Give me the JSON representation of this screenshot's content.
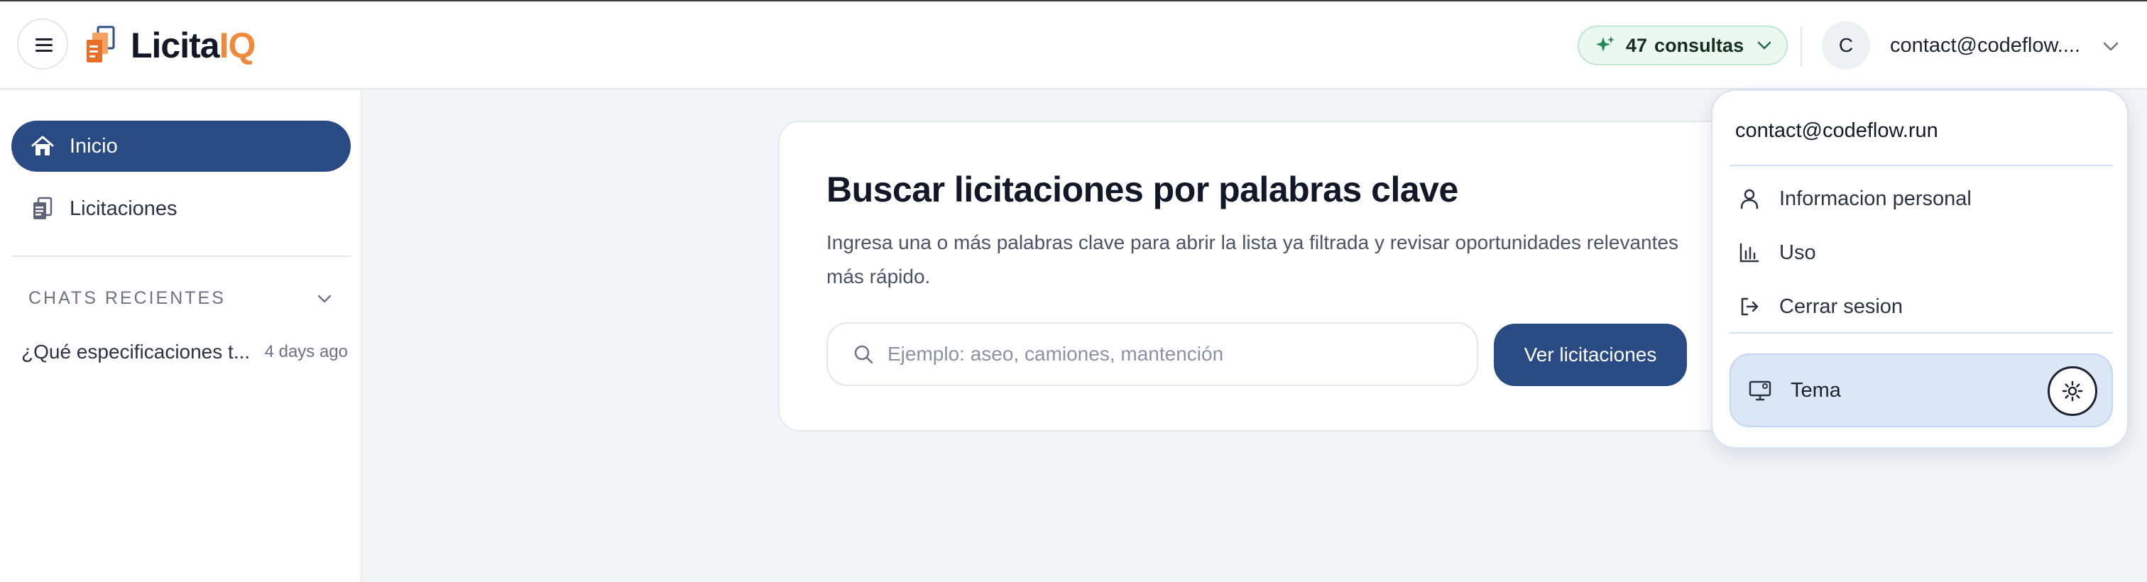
{
  "header": {
    "logo": {
      "part1": "Licita",
      "part2": "IQ"
    },
    "credits": {
      "count": "47",
      "label": "consultas"
    },
    "avatar_initial": "C",
    "user_email": "contact@codeflow...."
  },
  "sidebar": {
    "items": [
      {
        "label": "Inicio",
        "icon": "home-icon",
        "active": true
      },
      {
        "label": "Licitaciones",
        "icon": "documents-icon",
        "active": false
      }
    ],
    "recent_title": "CHATS RECIENTES",
    "chats": [
      {
        "title": "¿Qué especificaciones t...",
        "time": "4 days ago"
      }
    ]
  },
  "main": {
    "title": "Buscar licitaciones por palabras clave",
    "description": "Ingresa una o más palabras clave para abrir la lista ya filtrada y revisar oportunidades relevantes más rápido.",
    "search_placeholder": "Ejemplo: aseo, camiones, mantención",
    "search_value": "",
    "button_label": "Ver licitaciones"
  },
  "dropdown": {
    "email": "contact@codeflow.run",
    "items": [
      {
        "label": "Informacion personal",
        "icon": "user-icon"
      },
      {
        "label": "Uso",
        "icon": "bar-chart-icon"
      },
      {
        "label": "Cerrar sesion",
        "icon": "logout-icon"
      }
    ],
    "theme_label": "Tema"
  },
  "colors": {
    "primary": "#294a82",
    "accent_orange": "#ef8a3a",
    "credits_bg": "#eaf8ef",
    "credits_icon": "#1f8a53",
    "theme_bg": "#dbe7f5"
  }
}
